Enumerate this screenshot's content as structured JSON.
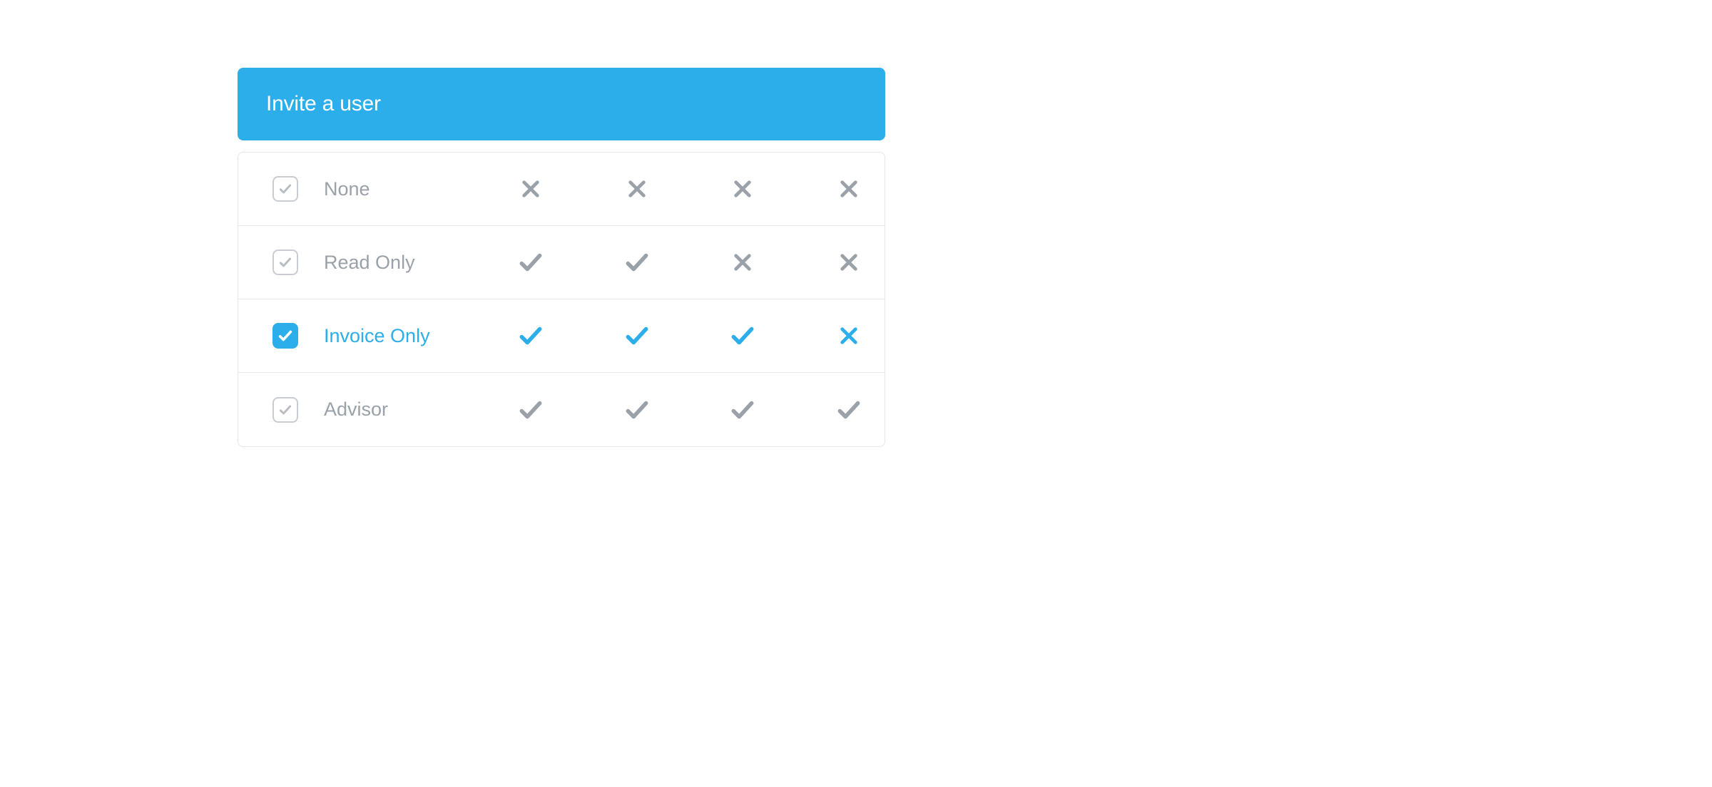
{
  "colors": {
    "accent": "#2BAEEA",
    "muted_text": "#9aa1a8",
    "border": "#e7e9eb"
  },
  "header": {
    "title": "Invite a user"
  },
  "roles": [
    {
      "id": "none",
      "label": "None",
      "selected": false,
      "permissions": [
        false,
        false,
        false,
        false
      ]
    },
    {
      "id": "read-only",
      "label": "Read Only",
      "selected": false,
      "permissions": [
        true,
        true,
        false,
        false
      ]
    },
    {
      "id": "invoice-only",
      "label": "Invoice Only",
      "selected": true,
      "permissions": [
        true,
        true,
        true,
        false
      ]
    },
    {
      "id": "advisor",
      "label": "Advisor",
      "selected": false,
      "permissions": [
        true,
        true,
        true,
        true
      ]
    }
  ]
}
